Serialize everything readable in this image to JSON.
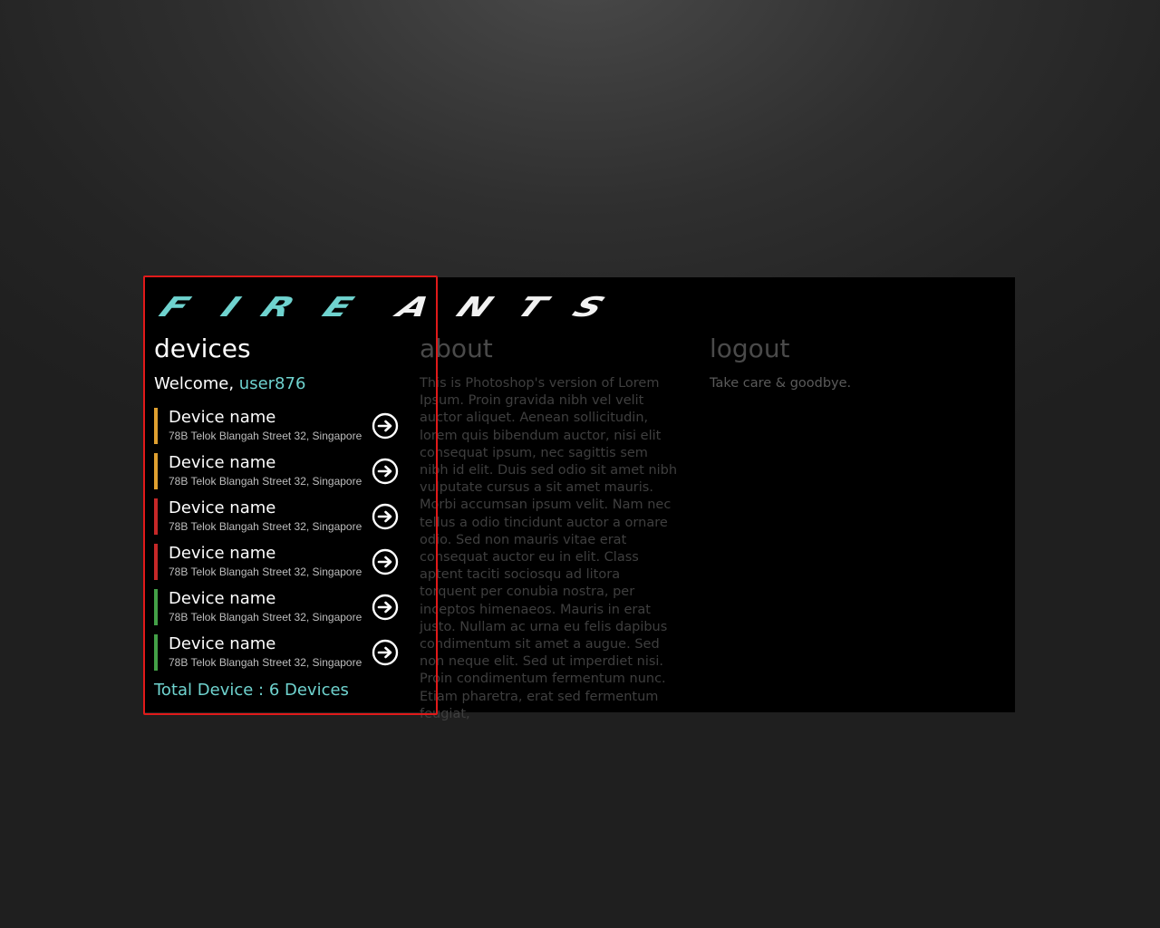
{
  "brand": {
    "logo_part1": "F I R E",
    "logo_part2": "A N T S",
    "colors": {
      "accent": "#6fd3cf",
      "logo_light": "#f2f2f2"
    }
  },
  "devices_panel": {
    "title": "devices",
    "welcome_prefix": "Welcome,",
    "username": "user876",
    "items": [
      {
        "name": "Device name",
        "address": "78B Telok Blangah Street 32, Singapore",
        "status_color": "#e0a030",
        "icon": "arrow-right-circle-icon"
      },
      {
        "name": "Device name",
        "address": "78B Telok Blangah Street 32, Singapore",
        "status_color": "#e0a030",
        "icon": "arrow-right-circle-icon"
      },
      {
        "name": "Device name",
        "address": "78B Telok Blangah Street 32, Singapore",
        "status_color": "#c62828",
        "icon": "arrow-right-circle-icon"
      },
      {
        "name": "Device name",
        "address": "78B Telok Blangah Street 32, Singapore",
        "status_color": "#c62828",
        "icon": "arrow-right-circle-icon"
      },
      {
        "name": "Device name",
        "address": "78B Telok Blangah Street 32, Singapore",
        "status_color": "#43a047",
        "icon": "arrow-right-circle-icon"
      },
      {
        "name": "Device name",
        "address": "78B Telok Blangah Street 32, Singapore",
        "status_color": "#43a047",
        "icon": "arrow-right-circle-icon"
      }
    ],
    "total": "Total Device : 6 Devices"
  },
  "about_panel": {
    "title": "about",
    "body": "This is Photoshop's version  of Lorem Ipsum. Proin gravida nibh vel velit auctor aliquet. Aenean sollicitudin, lorem quis bibendum auctor, nisi elit consequat ipsum, nec sagittis sem nibh id elit. Duis sed odio sit amet nibh vulputate cursus a sit amet mauris. Morbi accumsan ipsum velit. Nam nec tellus a odio tincidunt auctor a ornare odio. Sed non  mauris vitae erat consequat auctor eu in elit. Class aptent taciti sociosqu ad litora torquent per conubia nostra, per inceptos himenaeos. Mauris in erat justo. Nullam ac urna eu felis dapibus condimentum sit amet a augue. Sed non neque elit. Sed ut imperdiet nisi. Proin condimentum fermentum nunc. Etiam pharetra, erat sed fermentum feugiat,"
  },
  "logout_panel": {
    "title": "logout",
    "body": "Take care & goodbye."
  }
}
